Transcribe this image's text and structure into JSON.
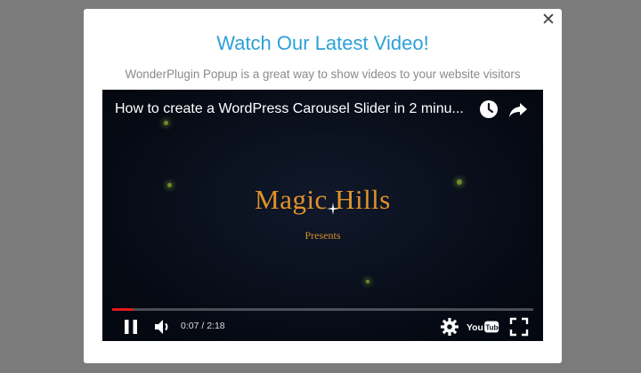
{
  "popup": {
    "title": "Watch Our Latest Video!",
    "subtitle": "WonderPlugin Popup is a great way to show videos to your website visitors",
    "close_icon": "close-icon"
  },
  "video": {
    "title": "How to create a WordPress Carousel Slider in 2 minu...",
    "brand_text": "Magic Hills",
    "presents_text": "Presents",
    "current_time": "0:07",
    "separator": " / ",
    "duration": "2:18",
    "progress_fraction": 0.051,
    "icons": [
      "watch-later-icon",
      "share-icon",
      "pause-icon",
      "volume-icon",
      "settings-icon",
      "youtube-logo",
      "fullscreen-icon"
    ],
    "logo_text": "YouTube"
  },
  "colors": {
    "title": "#2ba1d8",
    "brand": "#e0922a",
    "progress": "#e0191c",
    "overlay": "#7b7b7b"
  }
}
